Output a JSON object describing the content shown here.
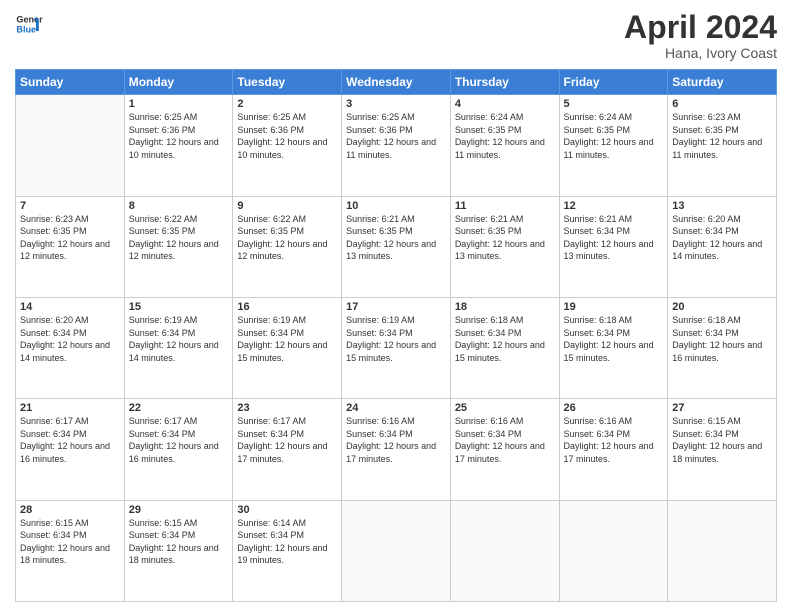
{
  "header": {
    "logo_line1": "General",
    "logo_line2": "Blue",
    "month_year": "April 2024",
    "location": "Hana, Ivory Coast"
  },
  "days_of_week": [
    "Sunday",
    "Monday",
    "Tuesday",
    "Wednesday",
    "Thursday",
    "Friday",
    "Saturday"
  ],
  "weeks": [
    [
      {
        "day": "",
        "sunrise": "",
        "sunset": "",
        "daylight": ""
      },
      {
        "day": "1",
        "sunrise": "6:25 AM",
        "sunset": "6:36 PM",
        "daylight": "12 hours and 10 minutes."
      },
      {
        "day": "2",
        "sunrise": "6:25 AM",
        "sunset": "6:36 PM",
        "daylight": "12 hours and 10 minutes."
      },
      {
        "day": "3",
        "sunrise": "6:25 AM",
        "sunset": "6:36 PM",
        "daylight": "12 hours and 11 minutes."
      },
      {
        "day": "4",
        "sunrise": "6:24 AM",
        "sunset": "6:35 PM",
        "daylight": "12 hours and 11 minutes."
      },
      {
        "day": "5",
        "sunrise": "6:24 AM",
        "sunset": "6:35 PM",
        "daylight": "12 hours and 11 minutes."
      },
      {
        "day": "6",
        "sunrise": "6:23 AM",
        "sunset": "6:35 PM",
        "daylight": "12 hours and 11 minutes."
      }
    ],
    [
      {
        "day": "7",
        "sunrise": "6:23 AM",
        "sunset": "6:35 PM",
        "daylight": "12 hours and 12 minutes."
      },
      {
        "day": "8",
        "sunrise": "6:22 AM",
        "sunset": "6:35 PM",
        "daylight": "12 hours and 12 minutes."
      },
      {
        "day": "9",
        "sunrise": "6:22 AM",
        "sunset": "6:35 PM",
        "daylight": "12 hours and 12 minutes."
      },
      {
        "day": "10",
        "sunrise": "6:21 AM",
        "sunset": "6:35 PM",
        "daylight": "12 hours and 13 minutes."
      },
      {
        "day": "11",
        "sunrise": "6:21 AM",
        "sunset": "6:35 PM",
        "daylight": "12 hours and 13 minutes."
      },
      {
        "day": "12",
        "sunrise": "6:21 AM",
        "sunset": "6:34 PM",
        "daylight": "12 hours and 13 minutes."
      },
      {
        "day": "13",
        "sunrise": "6:20 AM",
        "sunset": "6:34 PM",
        "daylight": "12 hours and 14 minutes."
      }
    ],
    [
      {
        "day": "14",
        "sunrise": "6:20 AM",
        "sunset": "6:34 PM",
        "daylight": "12 hours and 14 minutes."
      },
      {
        "day": "15",
        "sunrise": "6:19 AM",
        "sunset": "6:34 PM",
        "daylight": "12 hours and 14 minutes."
      },
      {
        "day": "16",
        "sunrise": "6:19 AM",
        "sunset": "6:34 PM",
        "daylight": "12 hours and 15 minutes."
      },
      {
        "day": "17",
        "sunrise": "6:19 AM",
        "sunset": "6:34 PM",
        "daylight": "12 hours and 15 minutes."
      },
      {
        "day": "18",
        "sunrise": "6:18 AM",
        "sunset": "6:34 PM",
        "daylight": "12 hours and 15 minutes."
      },
      {
        "day": "19",
        "sunrise": "6:18 AM",
        "sunset": "6:34 PM",
        "daylight": "12 hours and 15 minutes."
      },
      {
        "day": "20",
        "sunrise": "6:18 AM",
        "sunset": "6:34 PM",
        "daylight": "12 hours and 16 minutes."
      }
    ],
    [
      {
        "day": "21",
        "sunrise": "6:17 AM",
        "sunset": "6:34 PM",
        "daylight": "12 hours and 16 minutes."
      },
      {
        "day": "22",
        "sunrise": "6:17 AM",
        "sunset": "6:34 PM",
        "daylight": "12 hours and 16 minutes."
      },
      {
        "day": "23",
        "sunrise": "6:17 AM",
        "sunset": "6:34 PM",
        "daylight": "12 hours and 17 minutes."
      },
      {
        "day": "24",
        "sunrise": "6:16 AM",
        "sunset": "6:34 PM",
        "daylight": "12 hours and 17 minutes."
      },
      {
        "day": "25",
        "sunrise": "6:16 AM",
        "sunset": "6:34 PM",
        "daylight": "12 hours and 17 minutes."
      },
      {
        "day": "26",
        "sunrise": "6:16 AM",
        "sunset": "6:34 PM",
        "daylight": "12 hours and 17 minutes."
      },
      {
        "day": "27",
        "sunrise": "6:15 AM",
        "sunset": "6:34 PM",
        "daylight": "12 hours and 18 minutes."
      }
    ],
    [
      {
        "day": "28",
        "sunrise": "6:15 AM",
        "sunset": "6:34 PM",
        "daylight": "12 hours and 18 minutes."
      },
      {
        "day": "29",
        "sunrise": "6:15 AM",
        "sunset": "6:34 PM",
        "daylight": "12 hours and 18 minutes."
      },
      {
        "day": "30",
        "sunrise": "6:14 AM",
        "sunset": "6:34 PM",
        "daylight": "12 hours and 19 minutes."
      },
      {
        "day": "",
        "sunrise": "",
        "sunset": "",
        "daylight": ""
      },
      {
        "day": "",
        "sunrise": "",
        "sunset": "",
        "daylight": ""
      },
      {
        "day": "",
        "sunrise": "",
        "sunset": "",
        "daylight": ""
      },
      {
        "day": "",
        "sunrise": "",
        "sunset": "",
        "daylight": ""
      }
    ]
  ]
}
